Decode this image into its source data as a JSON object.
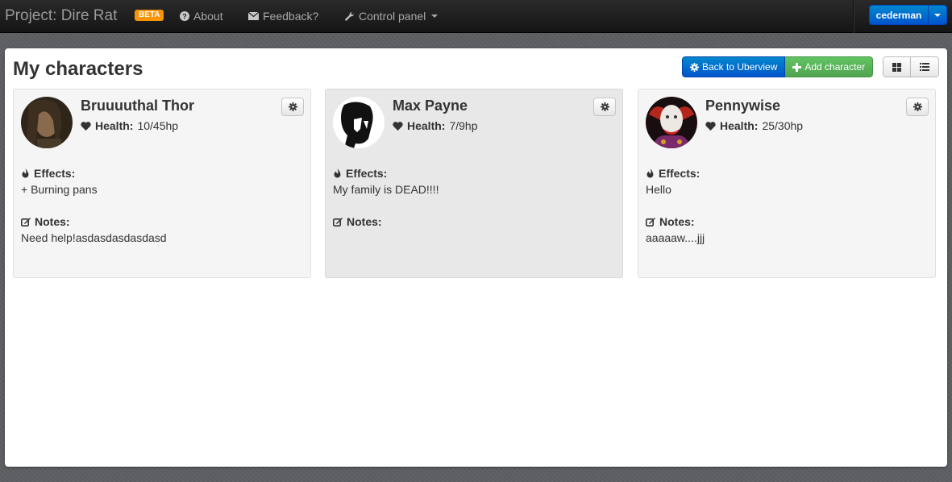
{
  "navbar": {
    "brand": "Project: Dire Rat",
    "beta": "BETA",
    "about": "About",
    "feedback": "Feedback?",
    "control_panel": "Control panel",
    "user": "cederman"
  },
  "page": {
    "title": "My characters",
    "back_button": "Back to Uberview",
    "add_button": "Add character"
  },
  "labels": {
    "health": "Health:",
    "effects": "Effects:",
    "notes": "Notes:"
  },
  "characters": [
    {
      "name": "Bruuuuthal Thor",
      "health": "10/45hp",
      "effects": "+ Burning pans",
      "notes": "Need help!asdasdasdasdasd"
    },
    {
      "name": "Max Payne",
      "health": "7/9hp",
      "effects": "My family is DEAD!!!!",
      "notes": ""
    },
    {
      "name": "Pennywise",
      "health": "25/30hp",
      "effects": "Hello",
      "notes": "aaaaaw....jjj"
    }
  ],
  "colors": {
    "navbar": "#1b1b1b",
    "primary": "#0066cc",
    "success": "#5bb75b",
    "beta": "#f89406"
  }
}
